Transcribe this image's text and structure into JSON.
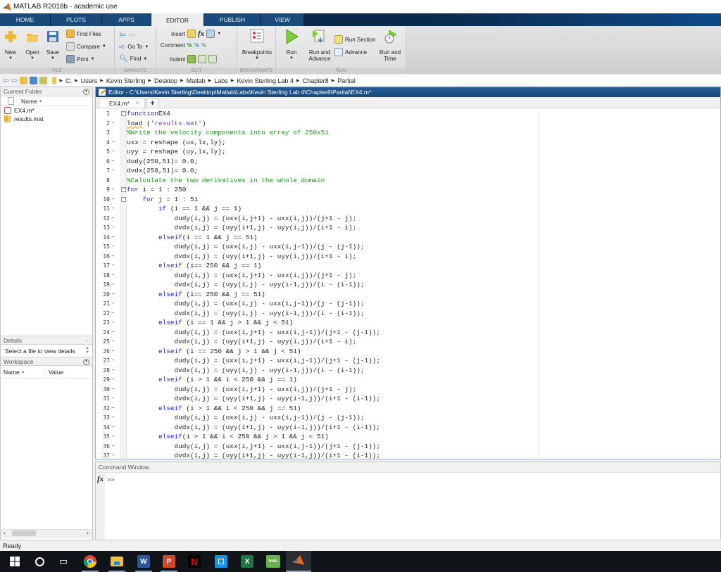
{
  "window": {
    "title": "MATLAB R2018b - academic use"
  },
  "tabs": [
    {
      "label": "HOME",
      "active": false
    },
    {
      "label": "PLOTS",
      "active": false
    },
    {
      "label": "APPS",
      "active": false
    },
    {
      "label": "EDITOR",
      "active": true
    },
    {
      "label": "PUBLISH",
      "active": false
    },
    {
      "label": "VIEW",
      "active": false
    }
  ],
  "ribbon": {
    "file": {
      "section_label": "FILE",
      "new": "New",
      "open": "Open",
      "save": "Save",
      "find_files": "Find Files",
      "compare": "Compare",
      "print": "Print"
    },
    "navigate": {
      "section_label": "NAVIGATE",
      "goto": "Go To",
      "find": "Find"
    },
    "edit": {
      "section_label": "EDIT",
      "insert": "Insert",
      "comment": "Comment",
      "indent": "Indent"
    },
    "breakpoints": {
      "section_label": "BREAKPOINTS",
      "breakpoints": "Breakpoints"
    },
    "run": {
      "section_label": "RUN",
      "run": "Run",
      "run_and_advance_1": "Run and",
      "run_and_advance_2": "Advance",
      "run_section": "Run Section",
      "advance": "Advance",
      "run_and_time_1": "Run and",
      "run_and_time_2": "Time"
    }
  },
  "address": {
    "crumbs": [
      "C:",
      "Users",
      "Kevin Sterling",
      "Desktop",
      "Matlab",
      "Labs",
      "Kevin Sterling Lab 4",
      "Chapter8",
      "Partial"
    ]
  },
  "current_folder": {
    "title": "Current Folder",
    "column_name": "Name",
    "files": [
      {
        "name": "EX4.m*",
        "icon": "matlab-file-icon"
      },
      {
        "name": "results.mat",
        "icon": "mat-file-icon"
      }
    ]
  },
  "details": {
    "title": "Details",
    "text": "Select a file to view details"
  },
  "workspace": {
    "title": "Workspace",
    "col_name": "Name",
    "col_value": "Value"
  },
  "editor": {
    "title": "Editor - C:\\Users\\Kevin Sterling\\Desktop\\Matlab\\Labs\\Kevin Sterling Lab 4\\Chapter8\\Partial\\EX4.m*",
    "tab_label": "EX4.m*",
    "lines": [
      {
        "n": "1",
        "dash": false,
        "fold": true,
        "indent": 0,
        "parts": [
          [
            "kw",
            "function"
          ],
          [
            "",
            "EX4"
          ]
        ]
      },
      {
        "n": "2",
        "dash": true,
        "fold": false,
        "indent": 0,
        "parts": [
          [
            "squig",
            "load"
          ],
          [
            "",
            " ("
          ],
          [
            "str",
            "'results.mat'"
          ],
          [
            "",
            ")"
          ]
        ]
      },
      {
        "n": "3",
        "dash": false,
        "fold": false,
        "indent": 0,
        "parts": [
          [
            "cm",
            "%Write the velocity components into array of 250x51"
          ]
        ]
      },
      {
        "n": "4",
        "dash": true,
        "fold": false,
        "indent": 0,
        "parts": [
          [
            "",
            "uxx = reshape (ux,lx,ly);"
          ]
        ]
      },
      {
        "n": "5",
        "dash": true,
        "fold": false,
        "indent": 0,
        "parts": [
          [
            "",
            "uyy = reshape (uy,lx,ly);"
          ]
        ]
      },
      {
        "n": "6",
        "dash": true,
        "fold": false,
        "indent": 0,
        "parts": [
          [
            "",
            "dudy(250,51)= 0.0;"
          ]
        ]
      },
      {
        "n": "7",
        "dash": true,
        "fold": false,
        "indent": 0,
        "parts": [
          [
            "",
            "dvdx(250,51)= 0.0;"
          ]
        ]
      },
      {
        "n": "8",
        "dash": false,
        "fold": false,
        "indent": 0,
        "parts": [
          [
            "cm",
            "%Calculate the two derivatives in the whole domain"
          ]
        ]
      },
      {
        "n": "9",
        "dash": true,
        "fold": true,
        "indent": 0,
        "parts": [
          [
            "kw",
            "for"
          ],
          [
            "",
            " i = 1 : 250"
          ]
        ]
      },
      {
        "n": "10",
        "dash": true,
        "fold": true,
        "indent": 1,
        "parts": [
          [
            "kw",
            "for"
          ],
          [
            "",
            " j = 1 : 51"
          ]
        ]
      },
      {
        "n": "11",
        "dash": true,
        "fold": false,
        "indent": 2,
        "parts": [
          [
            "kw",
            "if"
          ],
          [
            "",
            " (i == 1 && j == 1)"
          ]
        ]
      },
      {
        "n": "12",
        "dash": true,
        "fold": false,
        "indent": 3,
        "parts": [
          [
            "",
            "dudy(i,j) = (uxx(i,j+1) - uxx(i,j))/(j+1 - j);"
          ]
        ]
      },
      {
        "n": "13",
        "dash": true,
        "fold": false,
        "indent": 3,
        "parts": [
          [
            "",
            "dvdx(i,j) = (uyy(i+1,j) - uyy(i,j))/(i+1 - i);"
          ]
        ]
      },
      {
        "n": "14",
        "dash": true,
        "fold": false,
        "indent": 2,
        "parts": [
          [
            "kw",
            "elseif"
          ],
          [
            "",
            "(i == 1 && j == 51)"
          ]
        ]
      },
      {
        "n": "15",
        "dash": true,
        "fold": false,
        "indent": 3,
        "parts": [
          [
            "",
            "dudy(i,j) = (uxx(i,j) - uxx(i,j-1))/(j - (j-1));"
          ]
        ]
      },
      {
        "n": "16",
        "dash": true,
        "fold": false,
        "indent": 3,
        "parts": [
          [
            "",
            "dvdx(i,j) = (uyy(i+1,j) - uyy(i,j))/(i+1 - i);"
          ]
        ]
      },
      {
        "n": "17",
        "dash": true,
        "fold": false,
        "indent": 2,
        "parts": [
          [
            "kw",
            "elseif"
          ],
          [
            "",
            " (i== 250 && j == 1)"
          ]
        ]
      },
      {
        "n": "18",
        "dash": true,
        "fold": false,
        "indent": 3,
        "parts": [
          [
            "",
            "dudy(i,j) = (uxx(i,j+1) - uxx(i,j))/(j+1 - j);"
          ]
        ]
      },
      {
        "n": "19",
        "dash": true,
        "fold": false,
        "indent": 3,
        "parts": [
          [
            "",
            "dvdx(i,j) = (uyy(i,j) - uyy(i-1,j))/(i - (i-1));"
          ]
        ]
      },
      {
        "n": "20",
        "dash": true,
        "fold": false,
        "indent": 2,
        "parts": [
          [
            "kw",
            "elseif"
          ],
          [
            "",
            " (i== 250 && j == 51)"
          ]
        ]
      },
      {
        "n": "21",
        "dash": true,
        "fold": false,
        "indent": 3,
        "parts": [
          [
            "",
            "dudy(i,j) = (uxx(i,j) - uxx(i,j-1))/(j - (j-1));"
          ]
        ]
      },
      {
        "n": "22",
        "dash": true,
        "fold": false,
        "indent": 3,
        "parts": [
          [
            "",
            "dvdx(i,j) = (uyy(i,j) - uyy(i-1,j))/(i - (i-1));"
          ]
        ]
      },
      {
        "n": "23",
        "dash": true,
        "fold": false,
        "indent": 2,
        "parts": [
          [
            "kw",
            "elseif"
          ],
          [
            "",
            " (i == 1 && j > 1 && j < 51)"
          ]
        ]
      },
      {
        "n": "24",
        "dash": true,
        "fold": false,
        "indent": 3,
        "parts": [
          [
            "",
            "dudy(i,j) = (uxx(i,j+1) - uxx(i,j-1))/(j+1 - (j-1));"
          ]
        ]
      },
      {
        "n": "25",
        "dash": true,
        "fold": false,
        "indent": 3,
        "parts": [
          [
            "",
            "dvdx(i,j) = (uyy(i+1,j) - uyy(i,j))/(i+1 - i);"
          ]
        ]
      },
      {
        "n": "26",
        "dash": true,
        "fold": false,
        "indent": 2,
        "parts": [
          [
            "kw",
            "elseif"
          ],
          [
            "",
            " (i == 250 && j > 1 && j < 51)"
          ]
        ]
      },
      {
        "n": "27",
        "dash": true,
        "fold": false,
        "indent": 3,
        "parts": [
          [
            "",
            "dudy(i,j) = (uxx(i,j+1) - uxx(i,j-1))/(j+1 - (j-1));"
          ]
        ]
      },
      {
        "n": "28",
        "dash": true,
        "fold": false,
        "indent": 3,
        "parts": [
          [
            "",
            "dvdx(i,j) = (uyy(i,j) - uyy(i-1,j))/(i - (i-1));"
          ]
        ]
      },
      {
        "n": "29",
        "dash": true,
        "fold": false,
        "indent": 2,
        "parts": [
          [
            "kw",
            "elseif"
          ],
          [
            "",
            " (i > 1 && i < 250 && j == 1)"
          ]
        ]
      },
      {
        "n": "30",
        "dash": true,
        "fold": false,
        "indent": 3,
        "parts": [
          [
            "",
            "dudy(i,j) = (uxx(i,j+1) - uxx(i,j))/(j+1 - j);"
          ]
        ]
      },
      {
        "n": "31",
        "dash": true,
        "fold": false,
        "indent": 3,
        "parts": [
          [
            "",
            "dvdx(i,j) = (uyy(i+1,j) - uyy(i-1,j))/(i+1 - (i-1));"
          ]
        ]
      },
      {
        "n": "32",
        "dash": true,
        "fold": false,
        "indent": 2,
        "parts": [
          [
            "kw",
            "elseif"
          ],
          [
            "",
            " (i > 1 && i < 250 && j == 51)"
          ]
        ]
      },
      {
        "n": "33",
        "dash": true,
        "fold": false,
        "indent": 3,
        "parts": [
          [
            "",
            "dudy(i,j) = (uxx(i,j) - uxx(i,j-1))/(j - (j-1));"
          ]
        ]
      },
      {
        "n": "34",
        "dash": true,
        "fold": false,
        "indent": 3,
        "parts": [
          [
            "",
            "dvdx(i,j) = (uyy(i+1,j) - uyy(i-1,j))/(i+1 - (i-1));"
          ]
        ]
      },
      {
        "n": "35",
        "dash": true,
        "fold": false,
        "indent": 2,
        "parts": [
          [
            "kw",
            "elseif"
          ],
          [
            "",
            "(i > 1 && i < 250 && j > 1 && j < 51)"
          ]
        ]
      },
      {
        "n": "36",
        "dash": true,
        "fold": false,
        "indent": 3,
        "parts": [
          [
            "",
            "dudy(i,j) = (uxx(i,j+1) - uxx(i,j-1))/(j+1 - (j-1));"
          ]
        ]
      },
      {
        "n": "37",
        "dash": true,
        "fold": false,
        "indent": 3,
        "parts": [
          [
            "",
            "dvdx(i,j) = (uyy(i+1,j) - uyy(i-1,j))/(i+1 - (i-1));"
          ]
        ]
      }
    ]
  },
  "command_window": {
    "title": "Command Window",
    "fx": "fx",
    "prompt": ">>"
  },
  "status": {
    "text": "Ready"
  },
  "taskbar": {
    "items": [
      {
        "name": "start",
        "label": ""
      },
      {
        "name": "cortana",
        "label": ""
      },
      {
        "name": "task-view",
        "label": ""
      },
      {
        "name": "chrome",
        "label": ""
      },
      {
        "name": "file-explorer",
        "label": ""
      },
      {
        "name": "word",
        "label": "W"
      },
      {
        "name": "powerpoint",
        "label": "P"
      },
      {
        "name": "netflix",
        "label": "N"
      },
      {
        "name": "tablet-app",
        "label": ""
      },
      {
        "name": "excel",
        "label": "X"
      },
      {
        "name": "hulu",
        "label": "hulu"
      },
      {
        "name": "matlab",
        "label": ""
      }
    ]
  },
  "colors": {
    "keyword": "#1a1aff",
    "comment": "#228b22",
    "string": "#a020f0",
    "editor_title": "#1f5288",
    "tabstrip": "#0b2440"
  }
}
